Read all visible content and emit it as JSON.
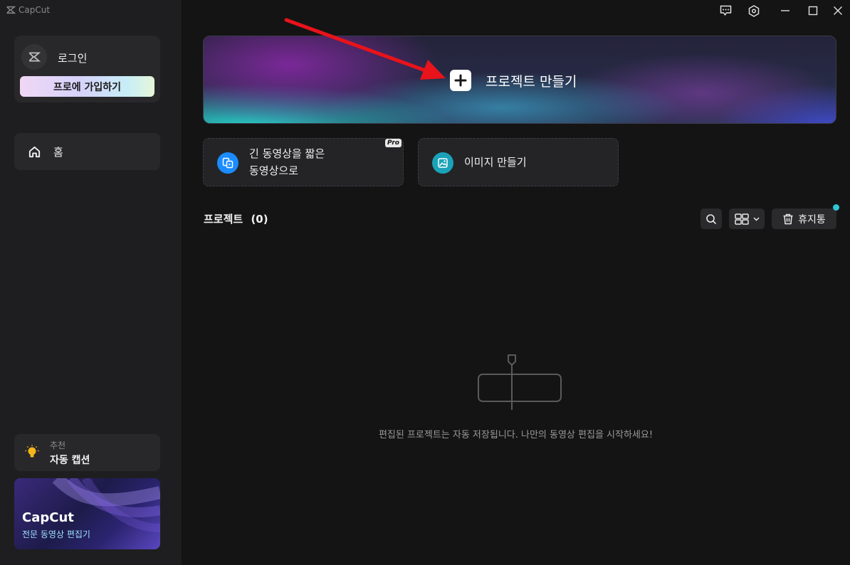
{
  "app": {
    "name": "CapCut"
  },
  "sidebar": {
    "login_label": "로그인",
    "pro_signup_label": "프로에 가입하기",
    "nav": [
      {
        "label": "홈",
        "icon": "home-icon"
      }
    ],
    "recommend": {
      "tag": "추천",
      "title": "자동 캡션",
      "icon": "lightbulb-icon"
    },
    "promo": {
      "brand": "CapCut",
      "subtitle": "전문 동영상 편집기"
    }
  },
  "titlebar": {
    "icons": [
      "feedback-icon",
      "settings-icon",
      "minimize-icon",
      "maximize-icon",
      "close-icon"
    ]
  },
  "main": {
    "create_project_label": "프로젝트 만들기",
    "tiles": [
      {
        "line1": "긴 동영상을 짧은",
        "line2": "동영상으로",
        "badge": "Pro",
        "icon": "long-to-short-icon",
        "color": "#1a8cff"
      },
      {
        "line1": "이미지 만들기",
        "icon": "image-icon",
        "color": "#1aa3b8"
      }
    ],
    "projects_label": "프로젝트",
    "projects_count": "(0)",
    "trash_label": "휴지통",
    "empty_message": "편집된 프로젝트는 자동 저장됩니다. 나만의 동영상 편집을 시작하세요!"
  },
  "colors": {
    "accent_arrow": "#e8131b",
    "notification_dot": "#2dc7d8"
  }
}
